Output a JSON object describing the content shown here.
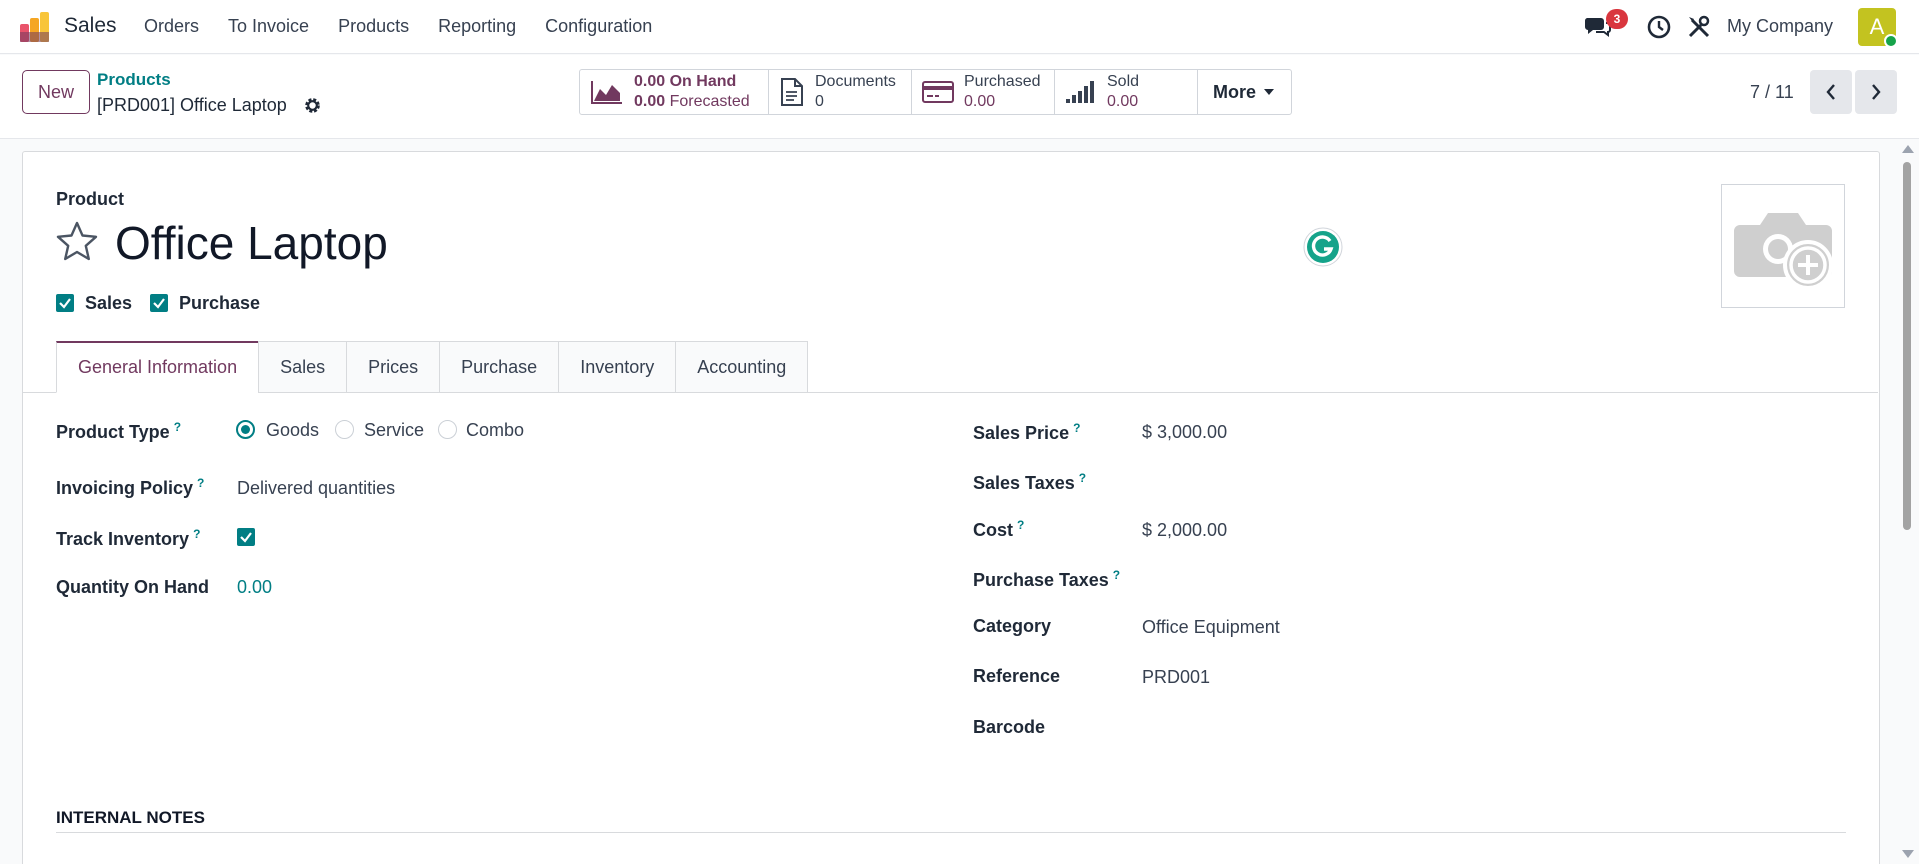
{
  "app": {
    "name": "Sales"
  },
  "nav": {
    "menu": [
      "Orders",
      "To Invoice",
      "Products",
      "Reporting",
      "Configuration"
    ],
    "chat_badge": "3",
    "company": "My Company",
    "avatar_letter": "A"
  },
  "control": {
    "new_label": "New",
    "breadcrumb": "Products",
    "record": "[PRD001] Office Laptop",
    "stats": {
      "onhand_value": "0.00",
      "onhand_label": "On Hand",
      "forecast_value": "0.00",
      "forecast_label": "Forecasted",
      "documents_label": "Documents",
      "documents_value": "0",
      "purchased_label": "Purchased",
      "purchased_value": "0.00",
      "sold_label": "Sold",
      "sold_value": "0.00",
      "more_label": "More"
    },
    "pager": "7 / 11"
  },
  "form": {
    "product_label": "Product",
    "title": "Office Laptop",
    "sales_check_label": "Sales",
    "purchase_check_label": "Purchase",
    "tabs": [
      "General Information",
      "Sales",
      "Prices",
      "Purchase",
      "Inventory",
      "Accounting"
    ],
    "left": {
      "product_type_label": "Product Type",
      "product_type_options": [
        "Goods",
        "Service",
        "Combo"
      ],
      "product_type_selected": "Goods",
      "invoicing_policy_label": "Invoicing Policy",
      "invoicing_policy_value": "Delivered quantities",
      "track_inventory_label": "Track Inventory",
      "track_inventory_checked": true,
      "qty_on_hand_label": "Quantity On Hand",
      "qty_on_hand_value": "0.00"
    },
    "right": {
      "sales_price_label": "Sales Price",
      "sales_price_value": "$ 3,000.00",
      "sales_taxes_label": "Sales Taxes",
      "cost_label": "Cost",
      "cost_value": "$ 2,000.00",
      "purchase_taxes_label": "Purchase Taxes",
      "category_label": "Category",
      "category_value": "Office Equipment",
      "reference_label": "Reference",
      "reference_value": "PRD001",
      "barcode_label": "Barcode"
    },
    "help_mark": "?",
    "internal_notes_label": "INTERNAL NOTES"
  },
  "colors": {
    "brand": "#71395f",
    "accent": "#017e84",
    "badge": "#d9363e",
    "avatar": "#c3c320"
  }
}
